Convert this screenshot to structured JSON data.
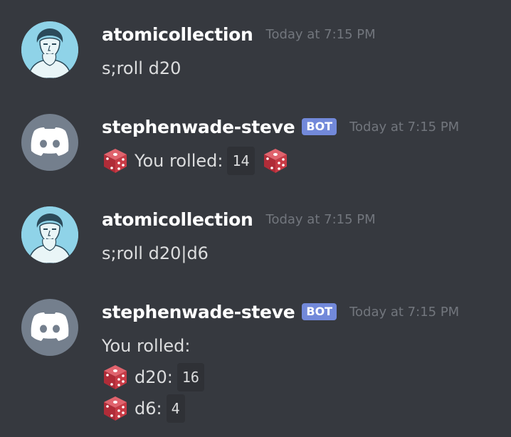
{
  "messages": [
    {
      "username": "atomicollection",
      "timestamp": "Today at 7:15 PM",
      "text": "s;roll d20"
    },
    {
      "username": "stephenwade-steve",
      "badge": "BOT",
      "timestamp": "Today at 7:15 PM",
      "prefix": "You rolled:",
      "result": "14"
    },
    {
      "username": "atomicollection",
      "timestamp": "Today at 7:15 PM",
      "text": "s;roll d20|d6"
    },
    {
      "username": "stephenwade-steve",
      "badge": "BOT",
      "timestamp": "Today at 7:15 PM",
      "intro": "You rolled:",
      "rolls": [
        {
          "die": "d20:",
          "value": "16"
        },
        {
          "die": "d6:",
          "value": "4"
        }
      ]
    }
  ],
  "icons": {
    "user_avatar": "sketch-portrait-avatar",
    "bot_avatar": "discord-logo-icon",
    "die": "game-die-icon"
  },
  "colors": {
    "background": "#36393f",
    "username": "#ffffff",
    "timestamp": "#72767d",
    "bot_badge": "#7289da",
    "bot_avatar_bg": "#747f8d",
    "user_avatar_bg": "#8fd3e8",
    "die": "#c1313d"
  }
}
